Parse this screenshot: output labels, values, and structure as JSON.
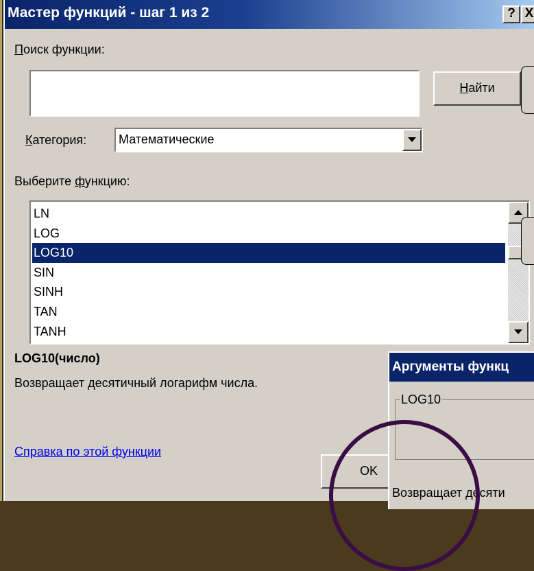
{
  "main_dialog": {
    "title": "Мастер функций - шаг 1 из 2",
    "help_btn": "?",
    "close_btn": "X",
    "search_label_accel": "П",
    "search_label_rest": "оиск функции:",
    "search_value": "",
    "find_label_accel": "Н",
    "find_label_rest": "айти",
    "category_label_accel": "К",
    "category_label_rest": "атегория:",
    "category_value": "Математические",
    "select_label_pre": "Выберите ",
    "select_label_accel": "ф",
    "select_label_rest": "ункцию:",
    "functions": [
      {
        "name": "LN"
      },
      {
        "name": "LOG"
      },
      {
        "name": "LOG10",
        "selected": true
      },
      {
        "name": "SIN"
      },
      {
        "name": "SINH"
      },
      {
        "name": "TAN"
      },
      {
        "name": "TANH"
      }
    ],
    "signature": "LOG10(число)",
    "description": "Возвращает десятичный логарифм числа.",
    "help_link": "Справка по этой функции",
    "ok_label": "OK"
  },
  "args_dialog": {
    "title": "Аргументы функц",
    "group_label": "LOG10",
    "description": "Возвращает десяти"
  },
  "colors": {
    "titlebar": "#0a246a",
    "selection": "#0a246a",
    "face": "#d4d0c8",
    "circle": "#3a0d45"
  }
}
